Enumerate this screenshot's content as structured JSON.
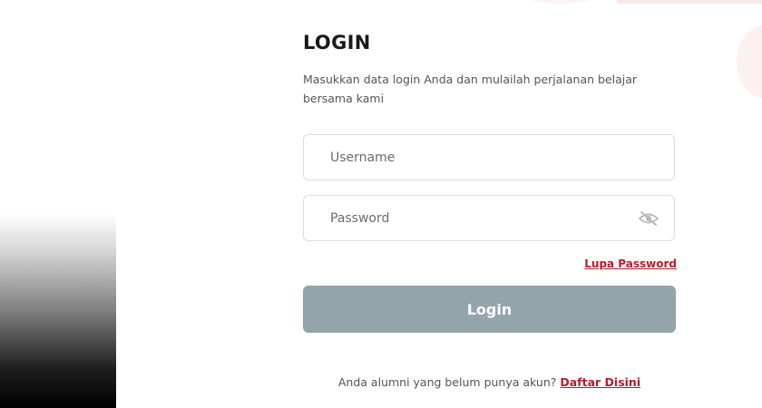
{
  "header": {
    "title": "LOGIN",
    "subtitle": "Masukkan data login Anda dan mulailah perjalanan belajar bersama kami"
  },
  "form": {
    "username_placeholder": "Username",
    "password_placeholder": "Password",
    "toggle_icon": "eye-slash-icon",
    "forgot_label": "Lupa Password",
    "login_label": "Login"
  },
  "footer": {
    "register_prompt": "Anda alumni yang belum punya akun?",
    "register_link": "Daftar Disini"
  },
  "colors": {
    "accent": "#b51d2a",
    "button": "#94a4ab",
    "field_border": "#d9dde1",
    "icon": "#b8b8b8"
  }
}
